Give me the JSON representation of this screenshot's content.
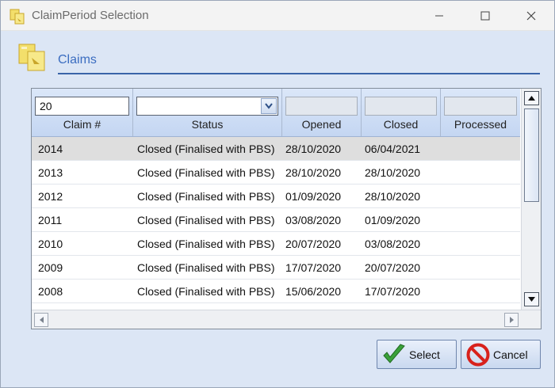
{
  "window": {
    "title": "ClaimPeriod Selection",
    "controls": [
      "minimize-icon",
      "maximize-icon",
      "close-icon"
    ]
  },
  "section": {
    "title": "Claims"
  },
  "grid": {
    "columns": [
      {
        "header": "Claim #",
        "filter": "20",
        "filter_type": "text"
      },
      {
        "header": "Status",
        "filter": "",
        "filter_type": "dropdown"
      },
      {
        "header": "Opened",
        "filter": "",
        "filter_type": "disabled"
      },
      {
        "header": "Closed",
        "filter": "",
        "filter_type": "disabled"
      },
      {
        "header": "Processed",
        "filter": "",
        "filter_type": "disabled"
      }
    ],
    "rows": [
      {
        "claim": "2014",
        "status": "Closed (Finalised with PBS)",
        "opened": "28/10/2020",
        "closed": "06/04/2021",
        "processed": "",
        "selected": true
      },
      {
        "claim": "2013",
        "status": "Closed (Finalised with PBS)",
        "opened": "28/10/2020",
        "closed": "28/10/2020",
        "processed": ""
      },
      {
        "claim": "2012",
        "status": "Closed (Finalised with PBS)",
        "opened": "01/09/2020",
        "closed": "28/10/2020",
        "processed": ""
      },
      {
        "claim": "2011",
        "status": "Closed (Finalised with PBS)",
        "opened": "03/08/2020",
        "closed": "01/09/2020",
        "processed": ""
      },
      {
        "claim": "2010",
        "status": "Closed (Finalised with PBS)",
        "opened": "20/07/2020",
        "closed": "03/08/2020",
        "processed": ""
      },
      {
        "claim": "2009",
        "status": "Closed (Finalised with PBS)",
        "opened": "17/07/2020",
        "closed": "20/07/2020",
        "processed": ""
      },
      {
        "claim": "2008",
        "status": "Closed (Finalised with PBS)",
        "opened": "15/06/2020",
        "closed": "17/07/2020",
        "processed": ""
      }
    ]
  },
  "buttons": {
    "select_label": "Select",
    "cancel_label": "Cancel"
  },
  "colors": {
    "accent": "#3a6cc0",
    "window_bg": "#dce6f5",
    "selected_row": "#dedede",
    "select_icon": "#3aa13a",
    "cancel_icon": "#d8211c"
  }
}
